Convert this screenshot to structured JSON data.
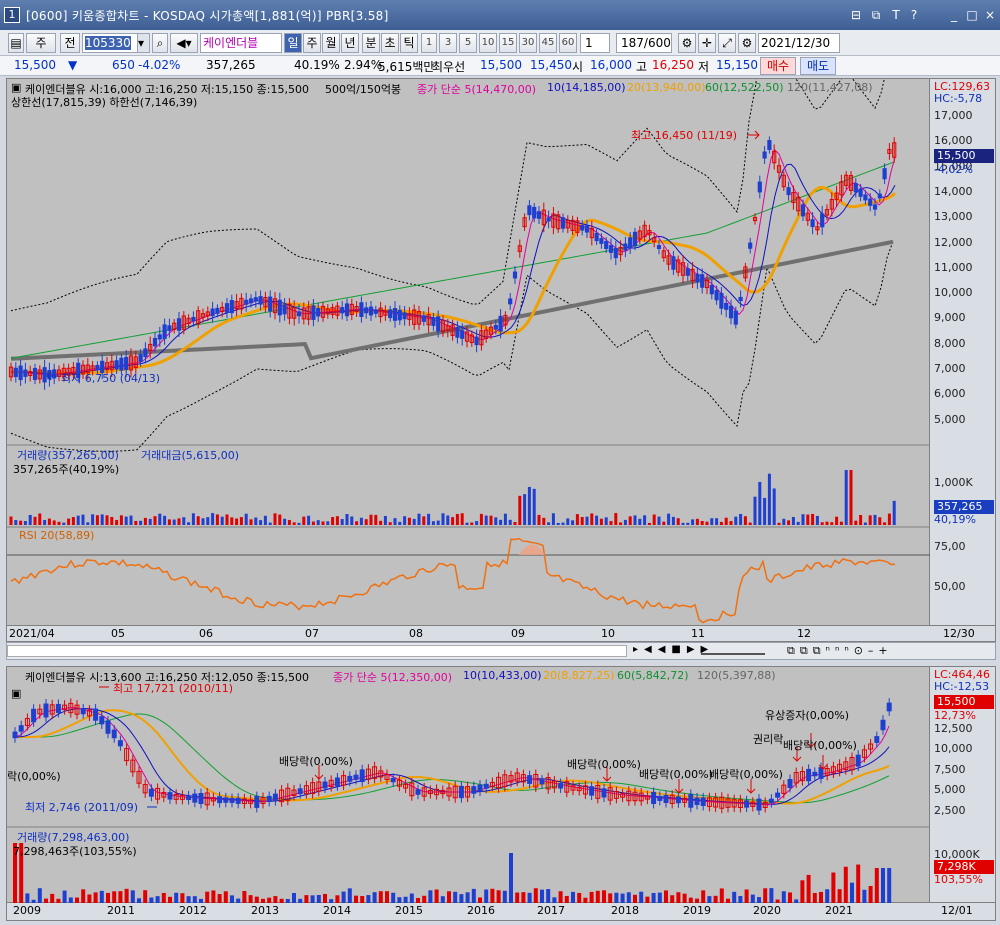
{
  "window": {
    "number": "1",
    "title": "[0600] 키움종합차트 - KOSDAQ 시가총액[1,881(억)] PBR[3.58]",
    "controls": [
      "⊟",
      "⧉",
      "T",
      "?",
      "_",
      "□",
      "×"
    ]
  },
  "toolbar": {
    "period_mode": "주",
    "prev_label": "전",
    "code": "105330",
    "name": "케이엔더블",
    "day": "일",
    "week": "주",
    "month": "월",
    "year": "년",
    "minute": "분",
    "second": "초",
    "tick": "틱",
    "intervals": [
      "1",
      "3",
      "5",
      "10",
      "15",
      "30",
      "45",
      "60"
    ],
    "interval_value": "1",
    "count": "187",
    "count_max": "/600",
    "date": "2021/12/30"
  },
  "quote": {
    "price": "15,500",
    "arrow": "▼",
    "change": "650",
    "change_pct": "-4.02%",
    "volume": "357,265",
    "vol_ratio": "40.19%",
    "turnover": "2.94%",
    "amount": "5,615백만",
    "best_bid_label": "최우선",
    "bid": "15,500",
    "ask": "15,450",
    "open_label": "시",
    "open": "16,000",
    "high_label": "고",
    "high": "16,250",
    "low_label": "저",
    "low": "15,150",
    "buy": "매수",
    "sell": "매도"
  },
  "top": {
    "legend_price": "케이엔더블유 시:16,000 고:16,250 저:15,150 종:15,500",
    "legend_filter": "500억/150억봉",
    "legend_ma_title": "종가 단순 5(14,470,00)",
    "legend_ma10": "10(14,185,00)",
    "legend_ma20": "20(13,940,00)",
    "legend_ma60": "60(12,522,50)",
    "legend_ma120": "120(11,427,08)",
    "legend_band": "상한선(17,815,39) 하한선(7,146,39)",
    "annot_high": "최고 16,450 (11/19)",
    "annot_low": "최저 6,750 (04/13)",
    "lc": "LC:129,63",
    "hc": "HC:-5,78",
    "price_box": "15,500",
    "price_pct": "-4,02%",
    "y_labels": [
      "17,000",
      "16,000",
      "15,000",
      "14,000",
      "13,000",
      "12,000",
      "11,000",
      "10,000",
      "9,000",
      "8,000",
      "7,000",
      "6,000",
      "5,000"
    ],
    "vol_title": "거래량(357,265,00)",
    "vol_amount_title": "거래대금(5,615,00)",
    "vol_sub": "357,265주(40,19%)",
    "vol_y": "1,000K",
    "vol_box": "357,265",
    "vol_pct": "40,19%",
    "rsi_title": "RSI 20(58,89)",
    "rsi_y": [
      "75,00",
      "50,00"
    ],
    "x_labels": [
      "2021/04",
      "05",
      "06",
      "07",
      "08",
      "09",
      "10",
      "11",
      "12",
      "12/30"
    ]
  },
  "bottom": {
    "legend_price": "케이엔더블유 시:13,600 고:16,250 저:12,050 종:15,500",
    "legend_ma_title": "종가 단순 5(12,350,00)",
    "legend_ma10": "10(10,433,00)",
    "legend_ma20": "20(8,827,25)",
    "legend_ma60": "60(5,842,72)",
    "legend_ma120": "120(5,397,88)",
    "annot_high": "최고 17,721 (2010/11)",
    "annot_low": "최저 2,746 (2011/09)",
    "annot_left": "락(0,00%)",
    "events": [
      "배당락(0,00%)",
      "배당락(0,00%)",
      "배당락(0,00%)",
      "배당락(0,00%)",
      "권리락",
      "배당락(0,00%)",
      "유상증자(0,00%)"
    ],
    "lc": "LC:464,46",
    "hc": "HC:-12,53",
    "price_box": "15,500",
    "price_pct": "12,73%",
    "y_labels": [
      "12,500",
      "10,000",
      "7,500",
      "5,000",
      "2,500"
    ],
    "vol_title": "거래량(7,298,463,00)",
    "vol_sub": "7,298,463주(103,55%)",
    "vol_y": "10,000K",
    "vol_box": "7,298K",
    "vol_pct": "103,55%",
    "x_labels": [
      "2009",
      "2011",
      "2012",
      "2013",
      "2014",
      "2015",
      "2016",
      "2017",
      "2018",
      "2019",
      "2020",
      "2021",
      "12/01"
    ]
  },
  "colors": {
    "up": "#e00000",
    "down": "#1e3fd0",
    "ma5": "#e000a0",
    "ma10": "#1010c0",
    "ma20": "#f0a000",
    "ma60": "#10a030",
    "ma120": "#707070",
    "rsi": "#f07010",
    "bg": "#c0c0c0"
  }
}
